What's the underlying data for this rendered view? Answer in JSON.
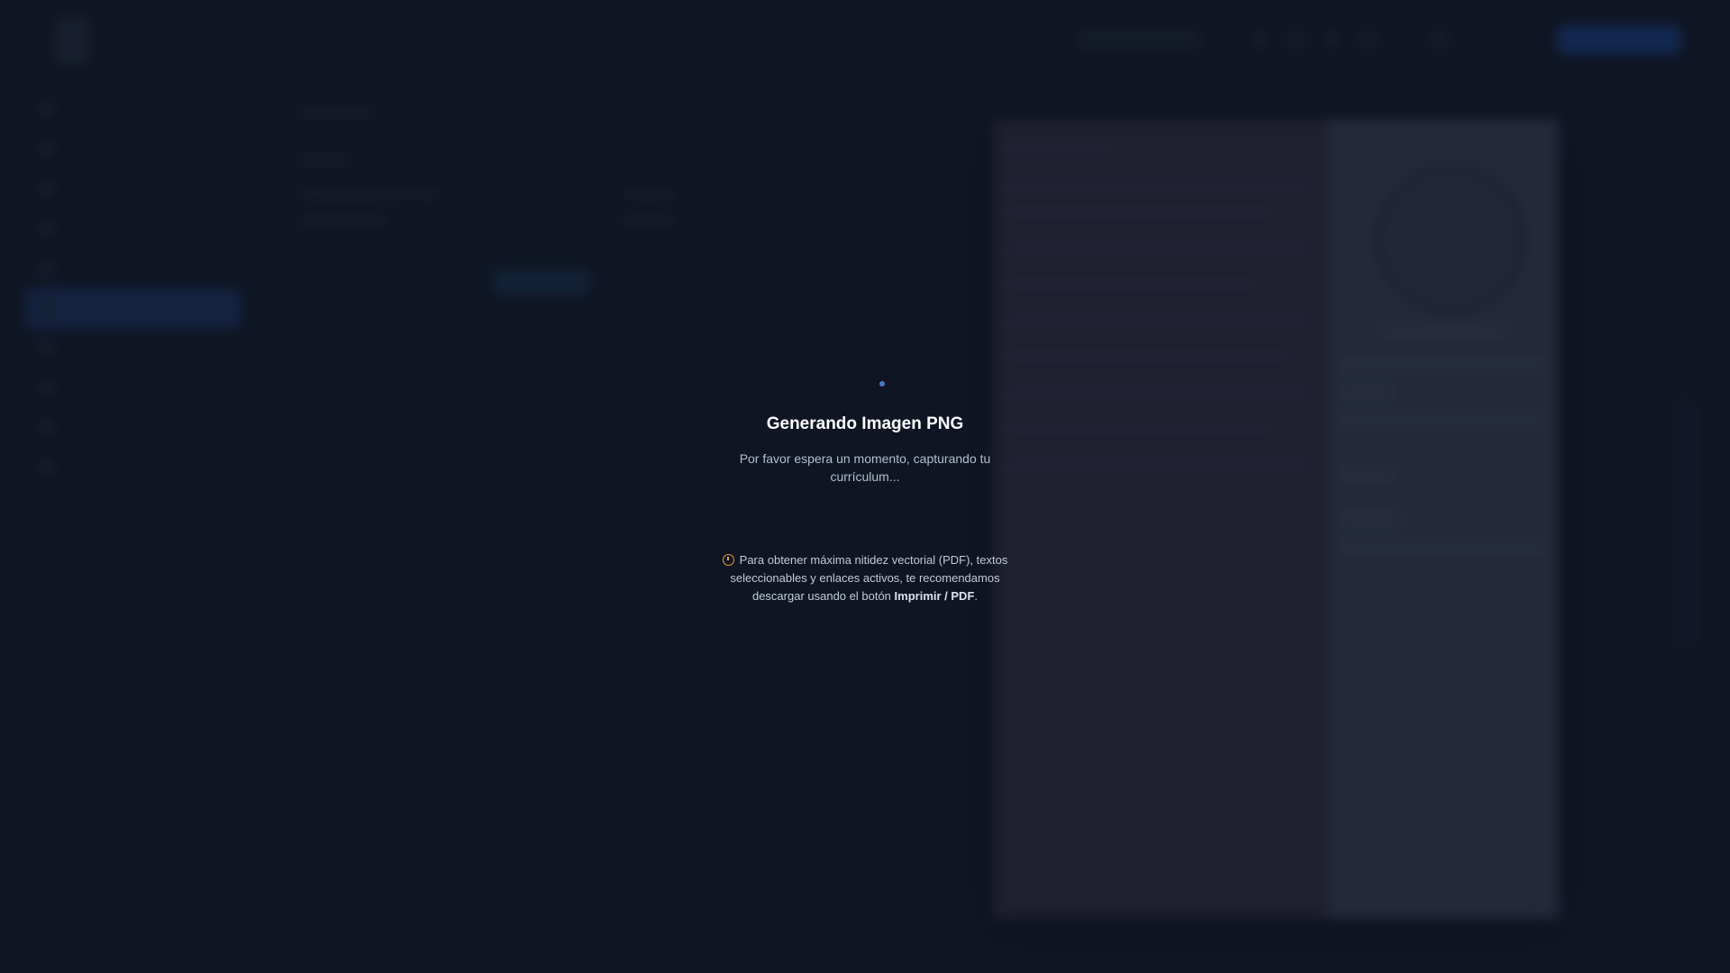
{
  "loading": {
    "title": "Generando Imagen PNG",
    "subtitle": "Por favor espera un momento, capturando tu currículum...",
    "notice_text_before": "Para obtener máxima nitidez vectorial (PDF), textos seleccionables y enlaces activos, te recomendamos descargar usando el botón ",
    "notice_strong": "Imprimir / PDF",
    "notice_text_after": ".",
    "notice_icon": "info-circle-icon",
    "notice_icon_color": "#e2a431",
    "spinner_color": "#4b78c6"
  },
  "colors": {
    "background": "#121827",
    "accent": "#1a4ea8"
  }
}
